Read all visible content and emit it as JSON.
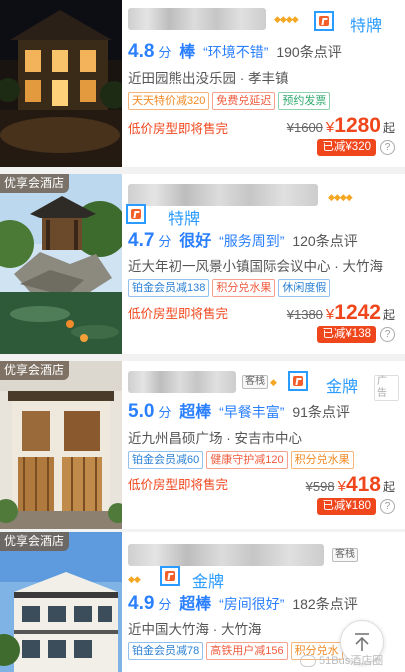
{
  "hotels": [
    {
      "promo_tag": "",
      "level": "特牌",
      "score": "4.8",
      "score_unit": "分",
      "rating_word": "棒",
      "quote": "“环境不错”",
      "reviews": "190条点评",
      "location": "近田园熊出没乐园 · 孝丰镇",
      "tags": [
        "天天特价减320",
        "免费兑延迟",
        "预约发票"
      ],
      "availability": "低价房型即将售完",
      "old_price": "¥1600",
      "currency": "¥",
      "price": "1280",
      "price_suffix": "起",
      "discount": "已减¥320",
      "help": "?"
    },
    {
      "promo_tag": "优享会酒店",
      "level": "特牌",
      "score": "4.7",
      "score_unit": "分",
      "rating_word": "很好",
      "quote": "“服务周到”",
      "reviews": "120条点评",
      "location": "近大年初一风景小镇国际会议中心 · 大竹海",
      "tags": [
        "铂金会员减138",
        "积分兑水果",
        "休闲度假"
      ],
      "availability": "低价房型即将售完",
      "old_price": "¥1380",
      "currency": "¥",
      "price": "1242",
      "price_suffix": "起",
      "discount": "已减¥138",
      "help": "?"
    },
    {
      "promo_tag": "优享会酒店",
      "badge": "客栈",
      "ad": "广告",
      "level": "金牌",
      "score": "5.0",
      "score_unit": "分",
      "rating_word": "超棒",
      "quote": "“早餐丰富”",
      "reviews": "91条点评",
      "location": "近九州昌硕广场 · 安吉市中心",
      "tags": [
        "铂金会员减60",
        "健康守护减120",
        "积分兑水果"
      ],
      "availability": "低价房型即将售完",
      "old_price": "¥598",
      "currency": "¥",
      "price": "418",
      "price_suffix": "起",
      "discount": "已减¥180",
      "help": "?"
    },
    {
      "promo_tag": "优享会酒店",
      "badge": "客栈",
      "level": "金牌",
      "score": "4.9",
      "score_unit": "分",
      "rating_word": "超棒",
      "quote": "“房间很好”",
      "reviews": "182条点评",
      "location": "近中国大竹海 · 大竹海",
      "tags": [
        "铂金会员减78",
        "高铁用户减156",
        "积分兑水"
      ],
      "availability": "",
      "old_price": "",
      "price": "",
      "discount": ""
    }
  ],
  "watermark": "51Bus酒店圈",
  "colors": {
    "accent": "#2a7fff",
    "price": "#f0461c",
    "diamond": "#f5a623",
    "highlight_box": "#2a9bff"
  },
  "icons": {
    "level_badge": "thumb-up-icon",
    "fab": "arrow-up-icon",
    "rating": "diamond-icon"
  }
}
